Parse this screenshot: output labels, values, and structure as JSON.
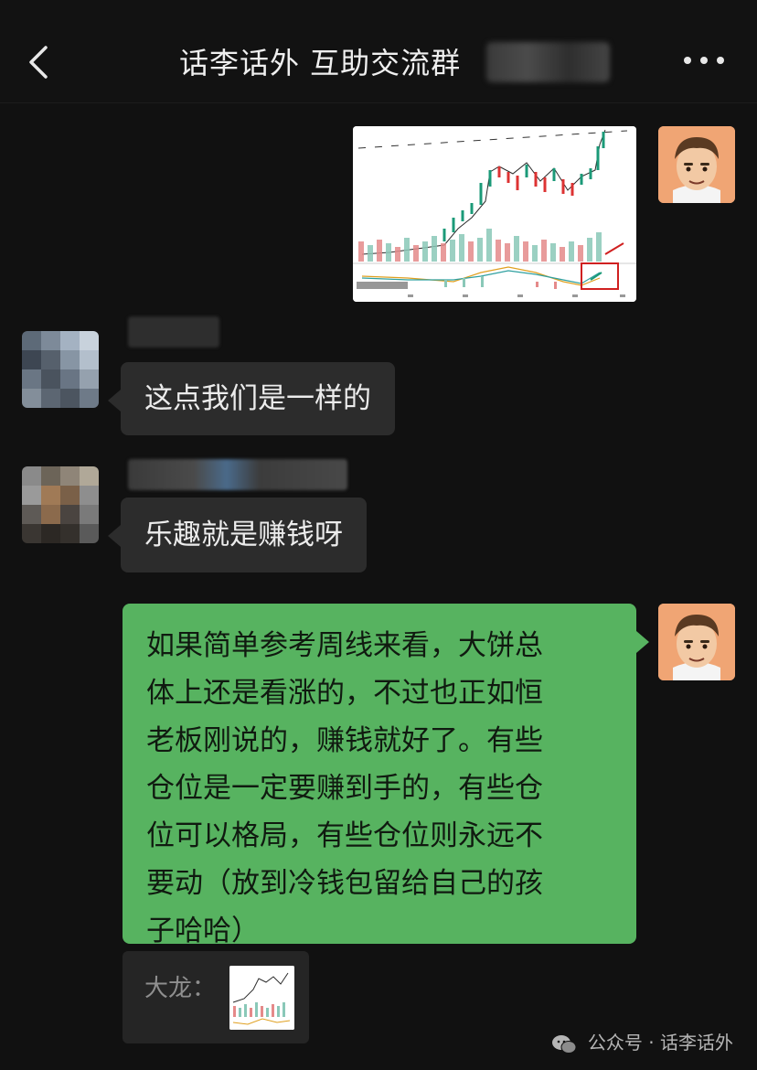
{
  "header": {
    "title": "话李话外 互助交流群",
    "back_icon": "chevron-left-icon",
    "more_icon": "more-dots-icon"
  },
  "messages": [
    {
      "type": "image",
      "sender": "me",
      "content": "candlestick chart screenshot"
    },
    {
      "type": "text",
      "sender": "other",
      "text": "这点我们是一样的"
    },
    {
      "type": "text",
      "sender": "other",
      "text": "乐趣就是赚钱呀"
    },
    {
      "type": "text",
      "sender": "me",
      "lines": [
        "如果简单参考周线来看，大饼总",
        "体上还是看涨的，不过也正如恒",
        "老板刚说的，赚钱就好了。有些",
        "仓位是一定要赚到手的，有些仓",
        "位可以格局，有些仓位则永远不",
        "要动（放到冷钱包留给自己的孩",
        "子哈哈）"
      ]
    }
  ],
  "quote": {
    "label": "大龙："
  },
  "watermark": {
    "text": "公众号 · 话李话外",
    "icon": "wechat-icon"
  },
  "colors": {
    "background": "#111111",
    "bubble_other": "#2c2c2c",
    "bubble_me": "#57b360",
    "avatar_me": "#f0a574"
  }
}
